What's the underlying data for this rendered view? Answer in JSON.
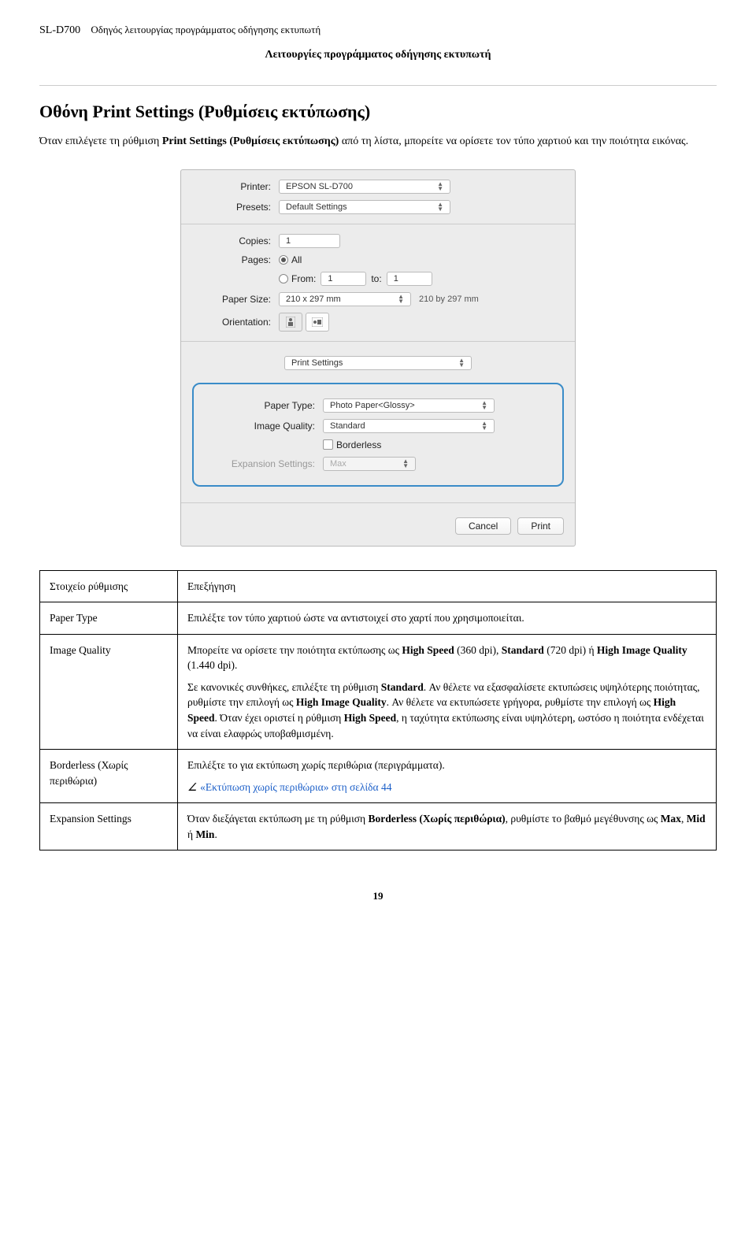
{
  "header": {
    "product": "SL-D700",
    "guide": "Οδηγός λειτουργίας προγράμματος οδήγησης εκτυπωτή",
    "subtitle": "Λειτουργίες προγράμματος οδήγησης εκτυπωτή"
  },
  "section_title": "Οθόνη Print Settings (Ρυθμίσεις εκτύπωσης)",
  "intro": {
    "pre": "Όταν επιλέγετε τη ρύθμιση ",
    "bold": "Print Settings (Ρυθμίσεις εκτύπωσης)",
    "post": " από τη λίστα, μπορείτε να ορίσετε τον τύπο χαρτιού και την ποιότητα εικόνας."
  },
  "dialog": {
    "printer_label": "Printer:",
    "printer_value": "EPSON SL-D700",
    "presets_label": "Presets:",
    "presets_value": "Default Settings",
    "copies_label": "Copies:",
    "copies_value": "1",
    "pages_label": "Pages:",
    "pages_all": "All",
    "pages_from": "From:",
    "pages_from_value": "1",
    "pages_to": "to:",
    "pages_to_value": "1",
    "papersize_label": "Paper Size:",
    "papersize_value": "210 x 297 mm",
    "papersize_note": "210 by 297 mm",
    "orientation_label": "Orientation:",
    "section_dropdown": "Print Settings",
    "papertype_label": "Paper Type:",
    "papertype_value": "Photo Paper<Glossy>",
    "imagequality_label": "Image Quality:",
    "imagequality_value": "Standard",
    "borderless_label": "Borderless",
    "expansion_label": "Expansion Settings:",
    "expansion_value": "Max",
    "cancel": "Cancel",
    "print": "Print"
  },
  "table": {
    "header_item": "Στοιχείο ρύθμισης",
    "header_desc": "Επεξήγηση",
    "rows": {
      "paper_type": {
        "label": "Paper Type",
        "desc": "Επιλέξτε τον τύπο χαρτιού ώστε να αντιστοιχεί στο χαρτί που χρησιμοποιείται."
      },
      "image_quality": {
        "label": "Image Quality",
        "p1_pre": "Μπορείτε να ορίσετε την ποιότητα εκτύπωσης ως ",
        "p1_b1": "High Speed",
        "p1_m1": " (360 dpi), ",
        "p1_b2": "Standard",
        "p1_m2": " (720 dpi) ή ",
        "p1_b3": "High Image Quality",
        "p1_post": " (1.440 dpi).",
        "p2_pre": "Σε κανονικές συνθήκες, επιλέξτε τη ρύθμιση ",
        "p2_b1": "Standard",
        "p2_m1": ". Αν θέλετε να εξασφαλίσετε εκτυπώσεις υψηλότερης ποιότητας, ρυθμίστε την επιλογή ως ",
        "p2_b2": "High Image Quality",
        "p2_m2": ". Αν θέλετε να εκτυπώσετε γρήγορα, ρυθμίστε την επιλογή ως ",
        "p2_b3": "High Speed",
        "p2_m3": ". Όταν έχει οριστεί η ρύθμιση ",
        "p2_b4": "High Speed",
        "p2_post": ", η ταχύτητα εκτύπωσης είναι υψηλότερη, ωστόσο η ποιότητα ενδέχεται να είναι ελαφρώς υποβαθμισμένη."
      },
      "borderless": {
        "label": "Borderless (Χωρίς περιθώρια)",
        "desc": "Επιλέξτε το για εκτύπωση χωρίς περιθώρια (περιγράμματα).",
        "link": "«Εκτύπωση χωρίς περιθώρια» στη σελίδα 44"
      },
      "expansion": {
        "label": "Expansion Settings",
        "pre": "Όταν διεξάγεται εκτύπωση με τη ρύθμιση ",
        "bold1": "Borderless (Χωρίς περιθώρια)",
        "mid": ", ρυθμίστε το βαθμό μεγέθυνσης ως ",
        "b_max": "Max",
        "sep1": ", ",
        "b_mid": "Mid",
        "sep2": " ή ",
        "b_min": "Min",
        "post": "."
      }
    }
  },
  "page_number": "19"
}
